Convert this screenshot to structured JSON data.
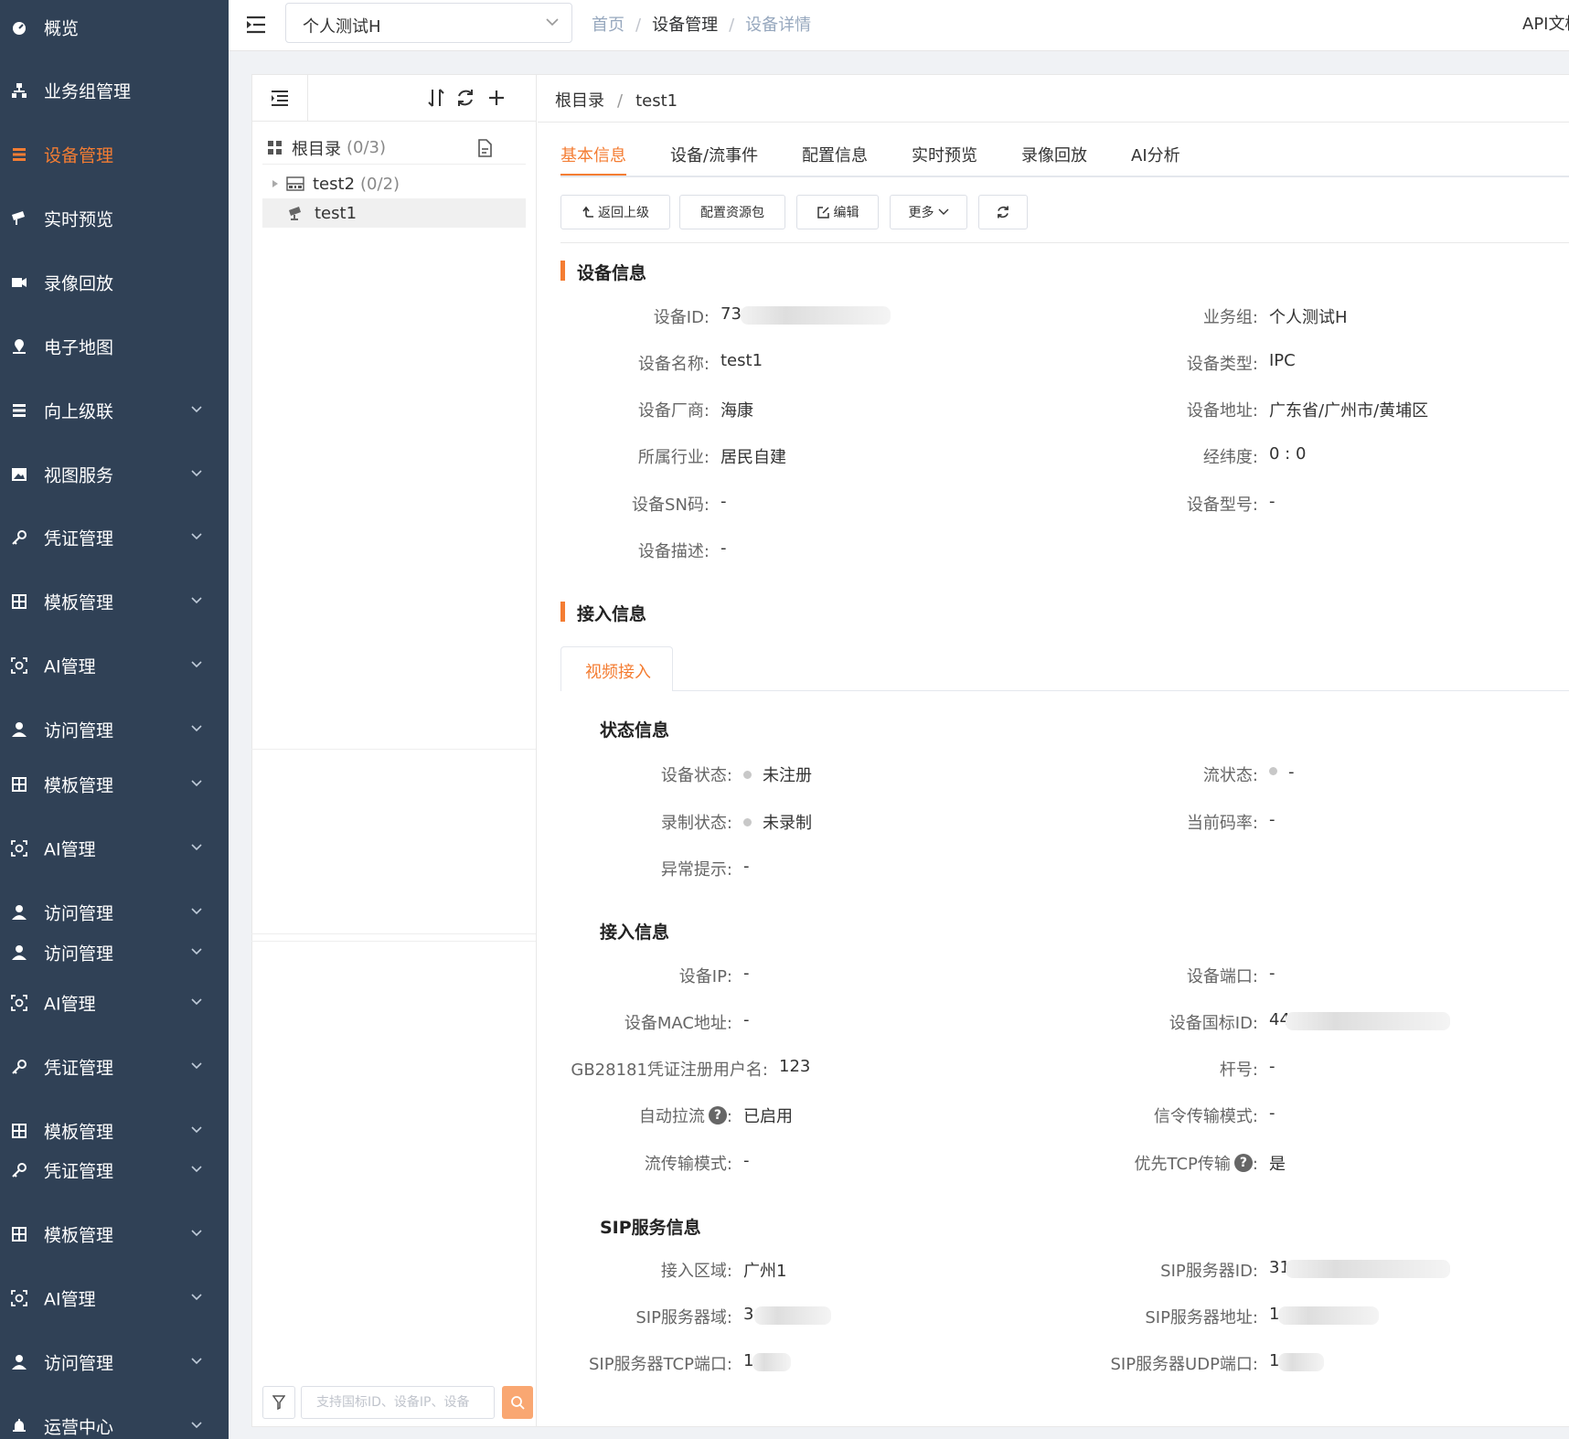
{
  "sidebar": {
    "items": [
      {
        "label": "概览",
        "icon": "dashboard-icon"
      },
      {
        "label": "业务组管理",
        "icon": "org-tree-icon"
      },
      {
        "label": "设备管理",
        "icon": "list-icon",
        "active": true
      },
      {
        "label": "实时预览",
        "icon": "camera-icon"
      },
      {
        "label": "录像回放",
        "icon": "video-icon"
      },
      {
        "label": "电子地图",
        "icon": "map-pin-icon"
      },
      {
        "label": "向上级联",
        "icon": "list-icon"
      },
      {
        "label": "视图服务",
        "icon": "image-icon"
      },
      {
        "label": "凭证管理",
        "icon": "key-icon"
      },
      {
        "label": "模板管理",
        "icon": "grid-icon"
      },
      {
        "label": "AI管理",
        "icon": "ai-icon"
      },
      {
        "label": "访问管理",
        "icon": "user-icon"
      },
      {
        "label": "模板管理",
        "icon": "grid-icon"
      },
      {
        "label": "AI管理",
        "icon": "ai-icon"
      },
      {
        "label": "访问管理",
        "icon": "user-icon"
      },
      {
        "label": "访问管理",
        "icon": "user-icon"
      },
      {
        "label": "AI管理",
        "icon": "ai-icon"
      },
      {
        "label": "凭证管理",
        "icon": "key-icon"
      },
      {
        "label": "模板管理",
        "icon": "grid-icon"
      },
      {
        "label": "凭证管理",
        "icon": "key-icon"
      },
      {
        "label": "模板管理",
        "icon": "grid-icon"
      },
      {
        "label": "AI管理",
        "icon": "ai-icon"
      },
      {
        "label": "访问管理",
        "icon": "user-icon"
      },
      {
        "label": "运营中心",
        "icon": "bell-icon"
      }
    ],
    "accent_color": "#f47d33",
    "bg_color": "#304156"
  },
  "header": {
    "group_select": "个人测试H",
    "breadcrumb": [
      "首页",
      "设备管理",
      "设备详情"
    ],
    "api_link": "API文档"
  },
  "tree": {
    "root": "根目录",
    "root_count": "(0/3)",
    "nodes": [
      {
        "label": "test2",
        "count": "(0/2)",
        "icon": "nvr-icon"
      },
      {
        "label": "test1",
        "count": "",
        "icon": "camera-icon",
        "selected": true
      }
    ],
    "search_placeholder": "支持国标ID、设备IP、设备"
  },
  "detail": {
    "breadcrumb": [
      "根目录",
      "test1"
    ],
    "tabs": [
      "基本信息",
      "设备/流事件",
      "配置信息",
      "实时预览",
      "录像回放",
      "AI分析"
    ],
    "buttons": {
      "back": "返回上级",
      "config": "配置资源包",
      "edit": "编辑",
      "more": "更多"
    },
    "device_info": {
      "title": "设备信息",
      "id_label": "设备ID:",
      "id_value": "73",
      "group_label": "业务组:",
      "group_value": "个人测试H",
      "name_label": "设备名称:",
      "name_value": "test1",
      "type_label": "设备类型:",
      "type_value": "IPC",
      "vendor_label": "设备厂商:",
      "vendor_value": "海康",
      "addr_label": "设备地址:",
      "addr_value": "广东省/广州市/黄埔区",
      "industry_label": "所属行业:",
      "industry_value": "居民自建",
      "latlng_label": "经纬度:",
      "latlng_value": "0 : 0",
      "sn_label": "设备SN码:",
      "sn_value": "-",
      "model_label": "设备型号:",
      "model_value": "-",
      "desc_label": "设备描述:",
      "desc_value": "-"
    },
    "access": {
      "title": "接入信息",
      "tab": "视频接入",
      "status_title": "状态信息",
      "dev_status_label": "设备状态:",
      "dev_status_value": "未注册",
      "stream_status_label": "流状态:",
      "stream_status_value": "-",
      "rec_status_label": "录制状态:",
      "rec_status_value": "未录制",
      "bitrate_label": "当前码率:",
      "bitrate_value": "-",
      "abnormal_label": "异常提示:",
      "abnormal_value": "-",
      "access_title": "接入信息",
      "ip_label": "设备IP:",
      "ip_value": "-",
      "port_label": "设备端口:",
      "port_value": "-",
      "mac_label": "设备MAC地址:",
      "mac_value": "-",
      "gbid_label": "设备国标ID:",
      "gbid_value": "44",
      "gbuser_label": "GB28181凭证注册用户名:",
      "gbuser_value": "123",
      "pole_label": "杆号:",
      "pole_value": "-",
      "autopull_label": "自动拉流",
      "autopull_value": "已启用",
      "signal_label": "信令传输模式:",
      "signal_value": "-",
      "stream_mode_label": "流传输模式:",
      "stream_mode_value": "-",
      "tcp_label": "优先TCP传输",
      "tcp_value": "是",
      "sip_title": "SIP服务信息",
      "region_label": "接入区域:",
      "region_value": "广州1",
      "sipid_label": "SIP服务器ID:",
      "sipid_value": "31",
      "sipdomain_label": "SIP服务器域:",
      "sipdomain_value": "3",
      "sipaddr_label": "SIP服务器地址:",
      "sipaddr_value": "1",
      "siptcp_label": "SIP服务器TCP端口:",
      "siptcp_value": "1",
      "sipudp_label": "SIP服务器UDP端口:",
      "sipudp_value": "1"
    }
  }
}
